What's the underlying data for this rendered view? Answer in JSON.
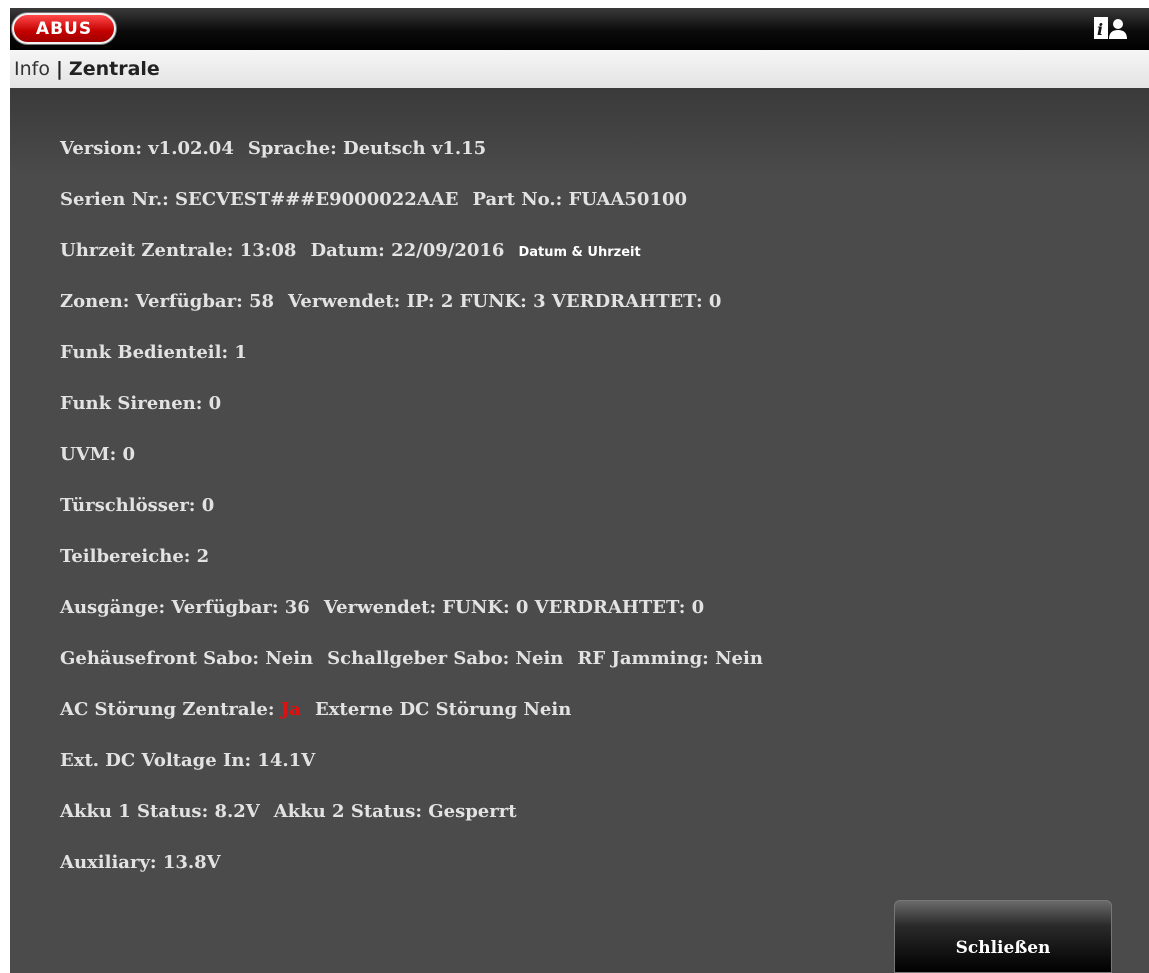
{
  "header": {
    "logo_text": "ABUS",
    "brand_color": "#d40000"
  },
  "breadcrumb": {
    "parent": "Info",
    "separator": "|",
    "current": "Zentrale"
  },
  "info": {
    "line1": {
      "version": "Version:  v1.02.04",
      "language": "Sprache:  Deutsch v1.15"
    },
    "line2": {
      "serial": "Serien Nr.:  SECVEST###E9000022AAE",
      "part": "Part No.:  FUAA50100"
    },
    "line3": {
      "time": "Uhrzeit Zentrale:  13:08",
      "date": "Datum: 22/09/2016",
      "link": "Datum & Uhrzeit"
    },
    "line4": {
      "available": "Zonen:  Verfügbar: 58",
      "used": "Verwendet:  IP: 2 FUNK: 3 VERDRAHTET: 0"
    },
    "line5": "Funk Bedienteil: 1",
    "line6": "Funk Sirenen: 0",
    "line7": "UVM: 0",
    "line8": "Türschlösser: 0",
    "line9": "Teilbereiche: 2",
    "line10": {
      "available": "Ausgänge: Verfügbar: 36",
      "used": "Verwendet:  FUNK: 0 VERDRAHTET: 0"
    },
    "line11": {
      "front": "Gehäusefront Sabo: Nein",
      "sounder": "Schallgeber Sabo: Nein",
      "jamming": "RF Jamming: Nein"
    },
    "line12": {
      "label": "AC Störung Zentrale:",
      "value": "Ja",
      "external": "Externe DC Störung Nein"
    },
    "line13": "Ext. DC Voltage In:  14.1V",
    "line14": {
      "akku1": "Akku 1 Status:  8.2V",
      "akku2": "Akku 2 Status: Gesperrt"
    },
    "line15": "Auxiliary:  13.8V"
  },
  "actions": {
    "close_label": "Schließen"
  },
  "icons": {
    "help": "help-icon",
    "user": "user-icon"
  }
}
